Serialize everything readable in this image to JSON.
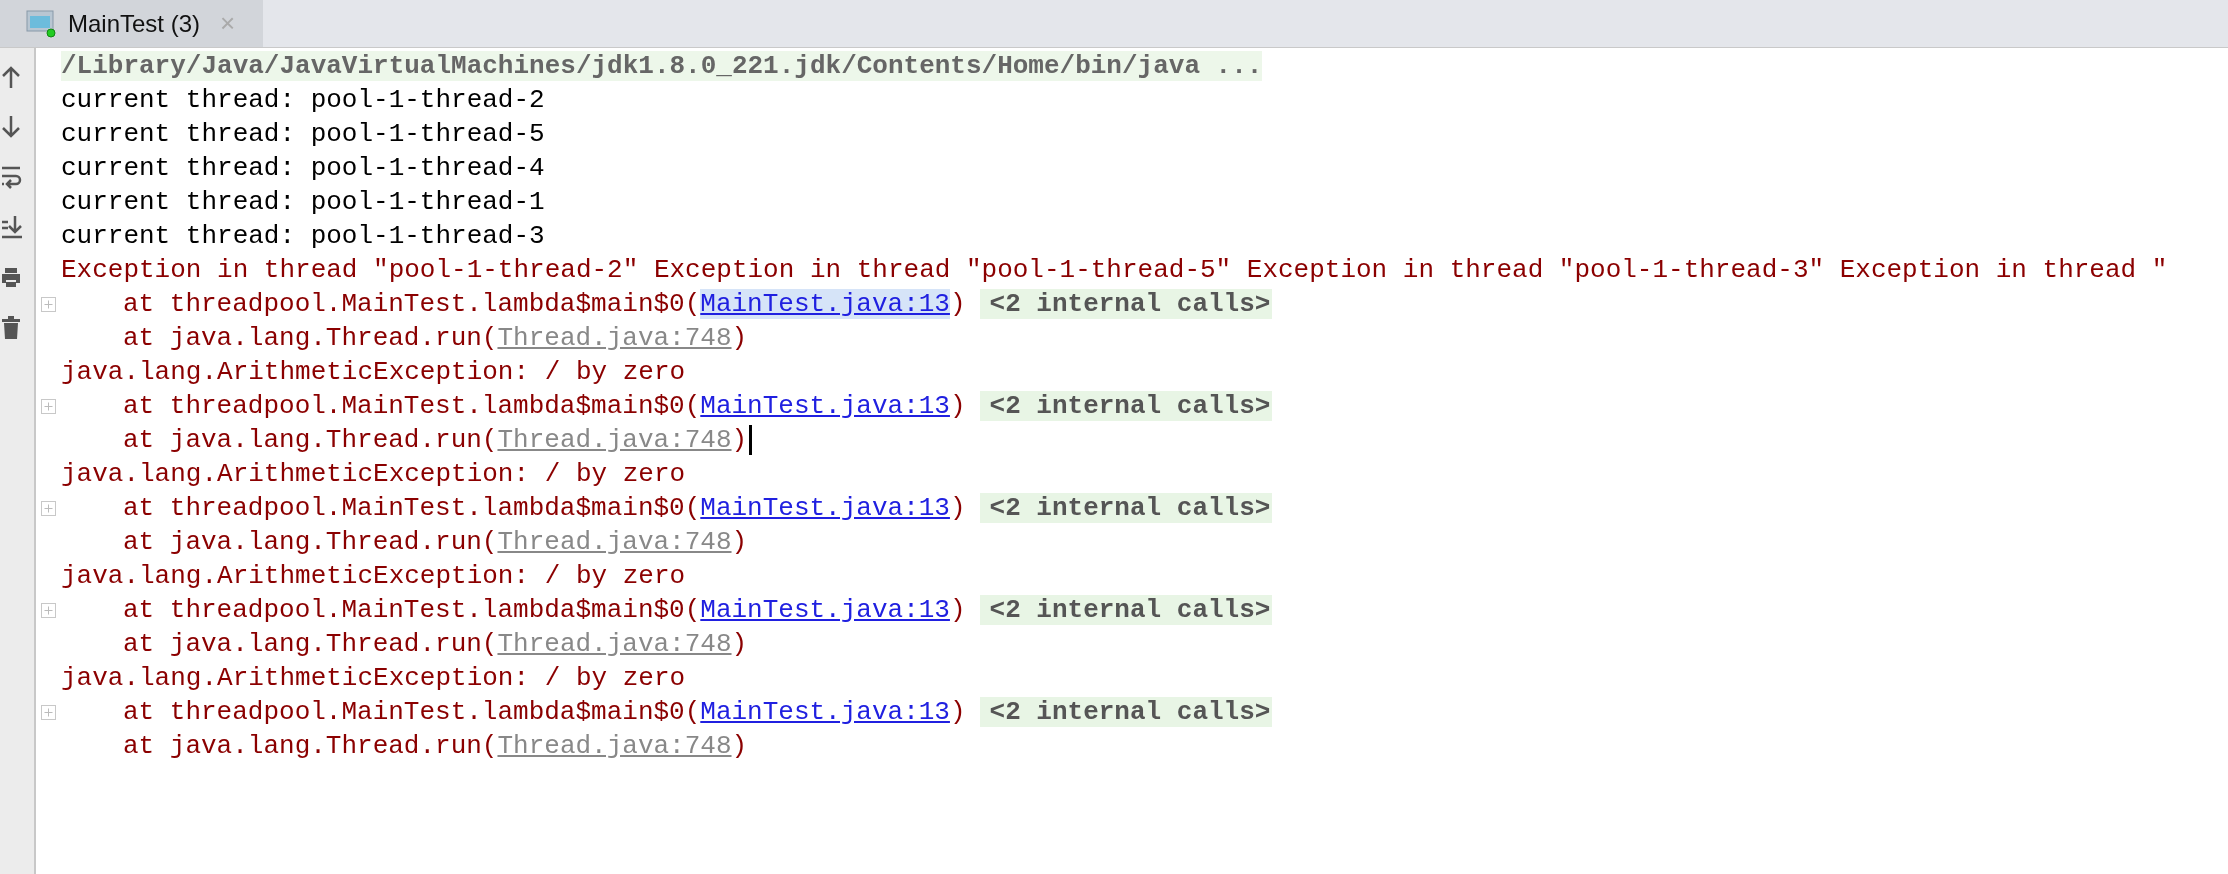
{
  "tab": {
    "label": "MainTest (3)",
    "close": "×",
    "selected": true
  },
  "lines": [
    {
      "kind": "command",
      "text": "/Library/Java/JavaVirtualMachines/jdk1.8.0_221.jdk/Contents/Home/bin/java ...",
      "caret": false
    },
    {
      "kind": "stdout",
      "text": "current thread: pool-1-thread-2",
      "caret": false
    },
    {
      "kind": "stdout",
      "text": "current thread: pool-1-thread-5",
      "caret": false
    },
    {
      "kind": "stdout",
      "text": "current thread: pool-1-thread-4",
      "caret": false
    },
    {
      "kind": "stdout",
      "text": "current thread: pool-1-thread-1",
      "caret": false
    },
    {
      "kind": "stdout",
      "text": "current thread: pool-1-thread-3",
      "caret": false
    },
    {
      "kind": "stderr",
      "text": "Exception in thread \"pool-1-thread-2\" Exception in thread \"pool-1-thread-5\" Exception in thread \"pool-1-thread-3\" Exception in thread \"",
      "caret": false
    },
    {
      "kind": "trace",
      "expandable": true,
      "prefix": "at threadpool.MainTest.lambda$main$0(",
      "link": {
        "text": "MainTest.java:13",
        "kind": "project",
        "selected": true
      },
      "suffix": ")",
      "folded": "<2 internal calls>",
      "caret": false
    },
    {
      "kind": "trace",
      "expandable": false,
      "prefix": "at java.lang.Thread.run(",
      "link": {
        "text": "Thread.java:748",
        "kind": "library",
        "selected": false
      },
      "suffix": ")",
      "caret": false
    },
    {
      "kind": "stderr",
      "text": "java.lang.ArithmeticException: / by zero",
      "caret": false
    },
    {
      "kind": "trace",
      "expandable": true,
      "prefix": "at threadpool.MainTest.lambda$main$0(",
      "link": {
        "text": "MainTest.java:13",
        "kind": "project",
        "selected": false
      },
      "suffix": ")",
      "folded": "<2 internal calls>",
      "caret": false
    },
    {
      "kind": "trace",
      "expandable": false,
      "prefix": "at java.lang.Thread.run(",
      "link": {
        "text": "Thread.java:748",
        "kind": "library",
        "selected": false
      },
      "suffix": ")",
      "caret": true
    },
    {
      "kind": "stderr",
      "text": "java.lang.ArithmeticException: / by zero",
      "caret": false
    },
    {
      "kind": "trace",
      "expandable": true,
      "prefix": "at threadpool.MainTest.lambda$main$0(",
      "link": {
        "text": "MainTest.java:13",
        "kind": "project",
        "selected": false
      },
      "suffix": ")",
      "folded": "<2 internal calls>",
      "caret": false
    },
    {
      "kind": "trace",
      "expandable": false,
      "prefix": "at java.lang.Thread.run(",
      "link": {
        "text": "Thread.java:748",
        "kind": "library",
        "selected": false
      },
      "suffix": ")",
      "caret": false
    },
    {
      "kind": "stderr",
      "text": "java.lang.ArithmeticException: / by zero",
      "caret": false
    },
    {
      "kind": "trace",
      "expandable": true,
      "prefix": "at threadpool.MainTest.lambda$main$0(",
      "link": {
        "text": "MainTest.java:13",
        "kind": "project",
        "selected": false
      },
      "suffix": ")",
      "folded": "<2 internal calls>",
      "caret": false
    },
    {
      "kind": "trace",
      "expandable": false,
      "prefix": "at java.lang.Thread.run(",
      "link": {
        "text": "Thread.java:748",
        "kind": "library",
        "selected": false
      },
      "suffix": ")",
      "caret": false
    },
    {
      "kind": "stderr",
      "text": "java.lang.ArithmeticException: / by zero",
      "caret": false
    },
    {
      "kind": "trace",
      "expandable": true,
      "prefix": "at threadpool.MainTest.lambda$main$0(",
      "link": {
        "text": "MainTest.java:13",
        "kind": "project",
        "selected": false
      },
      "suffix": ")",
      "folded": "<2 internal calls>",
      "caret": false
    },
    {
      "kind": "trace",
      "expandable": false,
      "prefix": "at java.lang.Thread.run(",
      "link": {
        "text": "Thread.java:748",
        "kind": "library",
        "selected": false
      },
      "suffix": ")",
      "caret": false
    }
  ]
}
